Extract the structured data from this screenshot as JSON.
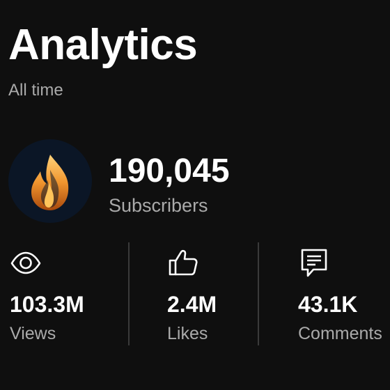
{
  "page": {
    "title": "Analytics",
    "period": "All time"
  },
  "channel": {
    "avatar_icon": "flame-logo-icon",
    "subscribers_value": "190,045",
    "subscribers_label": "Subscribers"
  },
  "stats": [
    {
      "icon": "eye-icon",
      "value": "103.3M",
      "label": "Views"
    },
    {
      "icon": "thumbs-up-icon",
      "value": "2.4M",
      "label": "Likes"
    },
    {
      "icon": "comment-icon",
      "value": "43.1K",
      "label": "Comments"
    }
  ],
  "colors": {
    "background": "#0f0f0f",
    "text_primary": "#ffffff",
    "text_secondary": "#aaaaaa",
    "divider": "#3a3a3a",
    "flame_orange": "#e8892a",
    "avatar_bg": "#0b1626"
  }
}
